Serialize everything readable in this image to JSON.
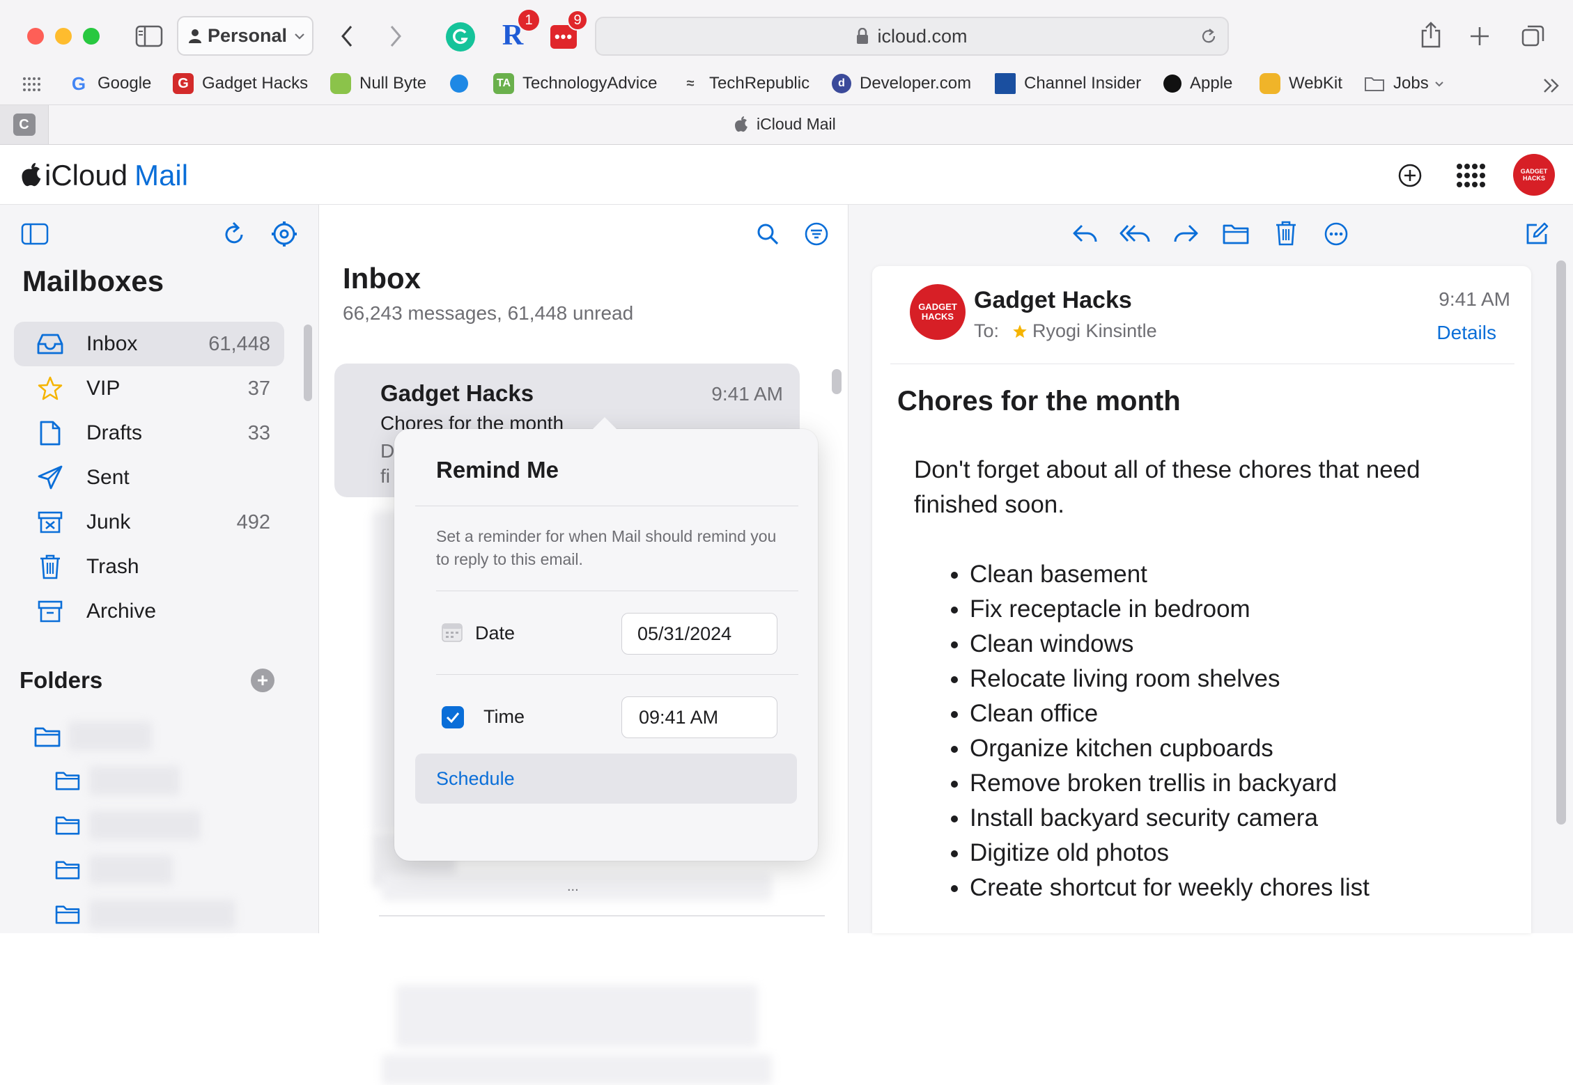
{
  "browser": {
    "profile": "Personal",
    "url": "icloud.com",
    "tab_title": "iCloud Mail",
    "tab_letter": "C",
    "grammarly_badge": "",
    "r_badge": "1",
    "red_badge": "9",
    "bookmarks": [
      {
        "label": "Google",
        "color": "#ffffff"
      },
      {
        "label": "Gadget Hacks",
        "color": "#d32a2a"
      },
      {
        "label": "Null Byte",
        "color": "#8bc34a"
      },
      {
        "label": "",
        "color": "#1e88e5"
      },
      {
        "label": "TechnologyAdvice",
        "color": "#6ab04c"
      },
      {
        "label": "TechRepublic",
        "color": "#444444"
      },
      {
        "label": "Developer.com",
        "color": "#3b4a9a"
      },
      {
        "label": "Channel Insider",
        "color": "#1a4fa0"
      },
      {
        "label": "Apple",
        "color": "#111111"
      },
      {
        "label": "WebKit",
        "color": "#f0b429"
      },
      {
        "label": "Jobs",
        "color": "#777777"
      }
    ]
  },
  "app": {
    "brand_icloud": "iCloud",
    "brand_mail": "Mail",
    "avatar_text": "GADGET HACKS",
    "accent": "#0a6ed8"
  },
  "sidebar": {
    "title": "Mailboxes",
    "items": [
      {
        "label": "Inbox",
        "count": "61,448",
        "icon": "inbox-icon"
      },
      {
        "label": "VIP",
        "count": "37",
        "icon": "star-icon"
      },
      {
        "label": "Drafts",
        "count": "33",
        "icon": "drafts-icon"
      },
      {
        "label": "Sent",
        "count": "",
        "icon": "sent-icon"
      },
      {
        "label": "Junk",
        "count": "492",
        "icon": "junk-icon"
      },
      {
        "label": "Trash",
        "count": "",
        "icon": "trash-icon"
      },
      {
        "label": "Archive",
        "count": "",
        "icon": "archive-icon"
      }
    ],
    "folders_title": "Folders"
  },
  "list": {
    "title": "Inbox",
    "subtitle": "66,243 messages, 61,448 unread",
    "selected": {
      "sender": "Gadget Hacks",
      "time": "9:41 AM",
      "subject": "Chores for the month",
      "preview1": "D",
      "preview2": "fi"
    },
    "ellipsis": "..."
  },
  "popover": {
    "title": "Remind Me",
    "description": "Set a reminder for when Mail should remind you to reply to this email.",
    "date_label": "Date",
    "date_value": "05/31/2024",
    "time_label": "Time",
    "time_value": "09:41 AM",
    "time_checked": true,
    "schedule_label": "Schedule"
  },
  "message": {
    "sender": "Gadget Hacks",
    "time": "9:41 AM",
    "to_label": "To:",
    "recipient": "Ryogi Kinsintle",
    "details_label": "Details",
    "subject": "Chores for the month",
    "intro": "Don't forget about all of these chores that need finished soon.",
    "chores": [
      "Clean basement",
      "Fix receptacle in bedroom",
      "Clean windows",
      "Relocate living room shelves",
      "Clean office",
      "Organize kitchen cupboards",
      "Remove broken trellis in backyard",
      "Install backyard security camera",
      "Digitize old photos",
      "Create shortcut for weekly chores list"
    ]
  }
}
